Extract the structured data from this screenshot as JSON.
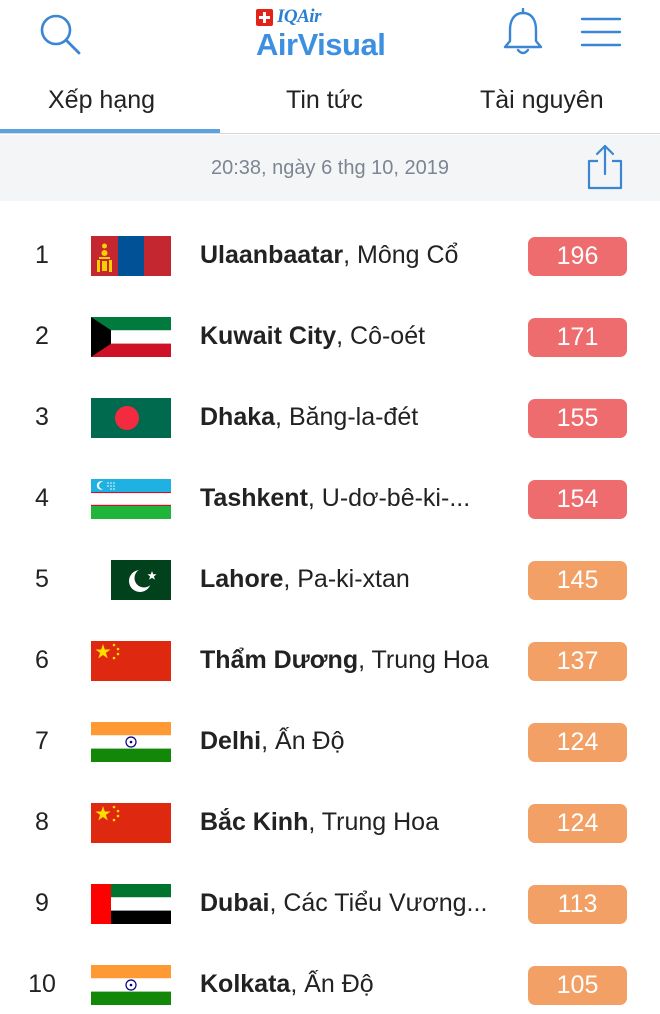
{
  "header": {
    "brand_small": "IQAir",
    "brand": "AirVisual",
    "icons": [
      "search-icon",
      "swiss-cross-icon",
      "bell-icon",
      "menu-icon"
    ]
  },
  "tabs": [
    {
      "label": "Xếp hạng",
      "active": true
    },
    {
      "label": "Tin tức",
      "active": false
    },
    {
      "label": "Tài nguyên",
      "active": false
    }
  ],
  "timestamp": "20:38, ngày 6 thg 10, 2019",
  "colors": {
    "unhealthy": "#ee6b6e",
    "sensitive": "#f3a066",
    "accent": "#5aa3de"
  },
  "ranking": [
    {
      "rank": "1",
      "city": "Ulaanbaatar",
      "country": ", Mông Cổ",
      "aqi": "196",
      "flag": "mongolia-flag-icon",
      "level": "unhealthy"
    },
    {
      "rank": "2",
      "city": "Kuwait City",
      "country": ", Cô-oét",
      "aqi": "171",
      "flag": "kuwait-flag-icon",
      "level": "unhealthy"
    },
    {
      "rank": "3",
      "city": "Dhaka",
      "country": ", Băng-la-đét",
      "aqi": "155",
      "flag": "bangladesh-flag-icon",
      "level": "unhealthy"
    },
    {
      "rank": "4",
      "city": "Tashkent",
      "country": ", U-dơ-bê-ki-...",
      "aqi": "154",
      "flag": "uzbekistan-flag-icon",
      "level": "unhealthy"
    },
    {
      "rank": "5",
      "city": "Lahore",
      "country": ", Pa-ki-xtan",
      "aqi": "145",
      "flag": "pakistan-flag-icon",
      "level": "sensitive"
    },
    {
      "rank": "6",
      "city": "Thẩm Dương",
      "country": ", Trung Hoa",
      "aqi": "137",
      "flag": "china-flag-icon",
      "level": "sensitive"
    },
    {
      "rank": "7",
      "city": "Delhi",
      "country": ", Ấn Độ",
      "aqi": "124",
      "flag": "india-flag-icon",
      "level": "sensitive"
    },
    {
      "rank": "8",
      "city": "Bắc Kinh",
      "country": ", Trung Hoa",
      "aqi": "124",
      "flag": "china-flag-icon",
      "level": "sensitive"
    },
    {
      "rank": "9",
      "city": "Dubai",
      "country": ", Các Tiểu Vương...",
      "aqi": "113",
      "flag": "uae-flag-icon",
      "level": "sensitive"
    },
    {
      "rank": "10",
      "city": "Kolkata",
      "country": ", Ấn Độ",
      "aqi": "105",
      "flag": "india-flag-icon",
      "level": "sensitive"
    }
  ]
}
